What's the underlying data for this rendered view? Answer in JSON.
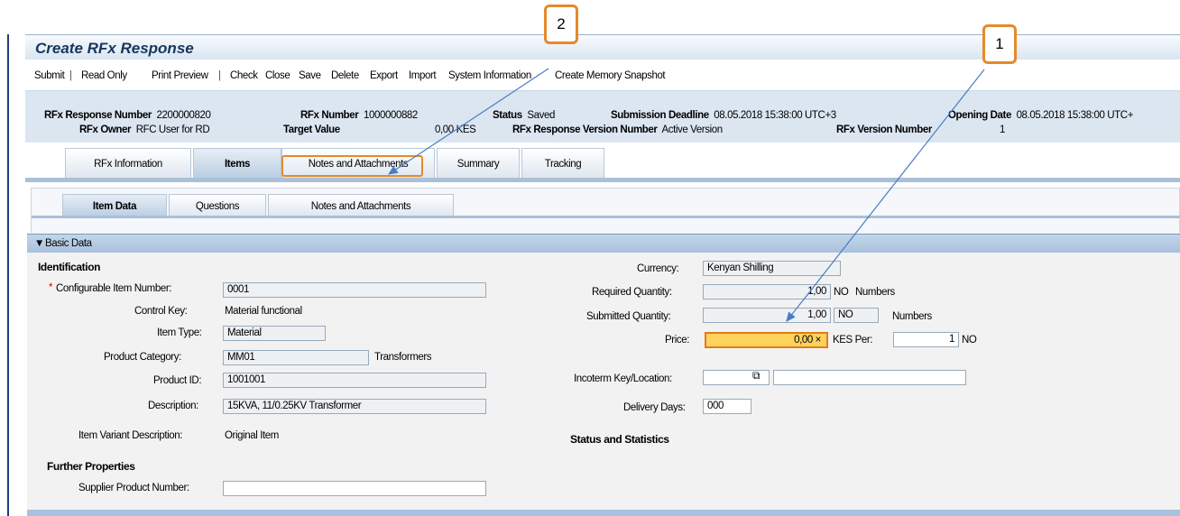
{
  "title": "Create RFx Response",
  "toolbar": {
    "submit": "Submit",
    "read_only": "Read Only",
    "print_preview": "Print Preview",
    "check": "Check",
    "close": "Close",
    "save": "Save",
    "delete": "Delete",
    "export": "Export",
    "import": "Import",
    "system_information": "System Information",
    "create_memory_snapshot": "Create Memory Snapshot",
    "separator": "|"
  },
  "header": {
    "rfx_response_number_label": "RFx Response Number",
    "rfx_response_number": "2200000820",
    "rfx_number_label": "RFx Number",
    "rfx_number": "1000000882",
    "status_label": "Status",
    "status": "Saved",
    "submission_deadline_label": "Submission Deadline",
    "submission_deadline": "08.05.2018 15:38:00 UTC+3",
    "opening_date_label": "Opening Date",
    "opening_date": "08.05.2018 15:38:00 UTC+",
    "rfx_owner_label": "RFx Owner",
    "rfx_owner": "RFC User for RD",
    "target_value_label": "Target Value",
    "target_value": "0,00 KES",
    "response_version_label": "RFx Response Version Number",
    "response_version": "Active Version",
    "rfx_version_label": "RFx Version Number",
    "rfx_version": "1"
  },
  "main_tabs": [
    "RFx Information",
    "Items",
    "Notes and Attachments",
    "Summary",
    "Tracking"
  ],
  "sub_tabs": [
    "Item Data",
    "Questions",
    "Notes and Attachments"
  ],
  "basic_data": {
    "section_title": "Basic Data",
    "identification_title": "Identification",
    "required_marker": "*",
    "configurable_item_number_label": "Configurable Item Number:",
    "configurable_item_number": "0001",
    "control_key_label": "Control Key:",
    "control_key": "Material functional",
    "item_type_label": "Item Type:",
    "item_type": "Material",
    "product_category_label": "Product Category:",
    "product_category": "MM01",
    "product_category_text": "Transformers",
    "product_id_label": "Product ID:",
    "product_id": "1001001",
    "description_label": "Description:",
    "description": "15KVA, 11/0.25KV Transformer",
    "item_variant_label": "Item Variant Description:",
    "item_variant": "Original Item",
    "further_properties_title": "Further Properties",
    "supplier_product_number_label": "Supplier Product Number:",
    "supplier_product_number": "",
    "currency_label": "Currency:",
    "currency": "Kenyan Shilling",
    "required_quantity_label": "Required Quantity:",
    "required_quantity": "1,00",
    "required_quantity_unit": "NO",
    "required_quantity_unit_text": "Numbers",
    "submitted_quantity_label": "Submitted Quantity:",
    "submitted_quantity": "1,00",
    "submitted_quantity_unit": "NO",
    "submitted_quantity_unit_text": "Numbers",
    "price_label": "Price:",
    "price": "0,00",
    "price_clear": "×",
    "price_currency_per": "KES Per:",
    "price_per_qty": "1",
    "price_per_unit": "NO",
    "incoterm_label": "Incoterm Key/Location:",
    "incoterm_key": "",
    "incoterm_location": "",
    "delivery_days_label": "Delivery Days:",
    "delivery_days": "000",
    "status_statistics_title": "Status and Statistics"
  },
  "callouts": {
    "one": "1",
    "two": "2"
  },
  "colors": {
    "highlight": "#e48a2a",
    "arrow": "#4a7cc4",
    "price_bg": "#ffd35a"
  }
}
